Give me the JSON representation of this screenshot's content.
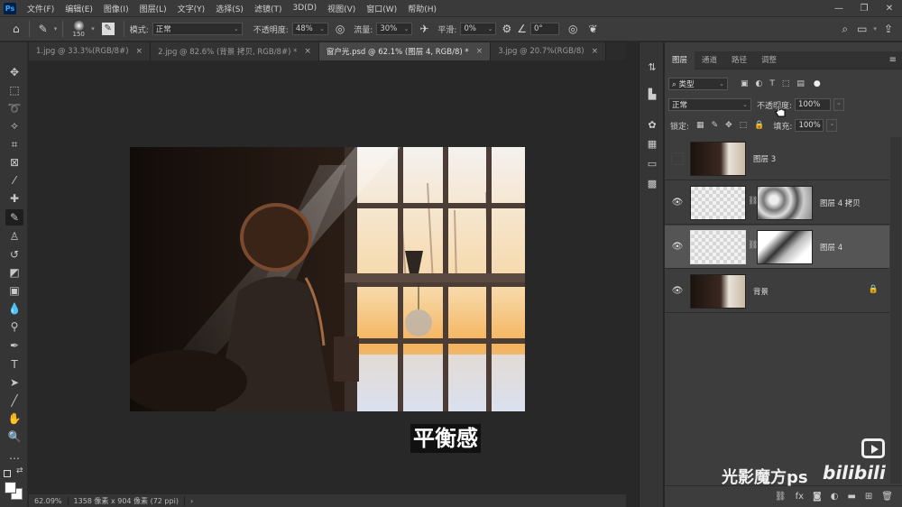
{
  "menubar": {
    "logo": "Ps",
    "items": [
      "文件(F)",
      "编辑(E)",
      "图像(I)",
      "图层(L)",
      "文字(Y)",
      "选择(S)",
      "滤镜(T)",
      "3D(D)",
      "视图(V)",
      "窗口(W)",
      "帮助(H)"
    ],
    "minimize": "—",
    "restore": "❐",
    "close": "✕"
  },
  "options": {
    "brush_size": "150",
    "mode_label": "模式:",
    "mode_value": "正常",
    "opacity_label": "不透明度:",
    "opacity_value": "48%",
    "flow_label": "流量:",
    "flow_value": "30%",
    "smoothing_label": "平滑:",
    "smoothing_value": "0%",
    "angle_value": "0°"
  },
  "tabs": [
    {
      "label": "1.jpg @ 33.3%(RGB/8#)",
      "close": "×"
    },
    {
      "label": "2.jpg @ 82.6% (背景 拷贝, RGB/8#) *",
      "close": "×"
    },
    {
      "label": "窗户光.psd @ 62.1% (图层 4, RGB/8) *",
      "close": "×"
    },
    {
      "label": "3.jpg @ 20.7%(RGB/8)",
      "close": "×"
    }
  ],
  "subtitle": "平衡感",
  "status": {
    "zoom": "62.09%",
    "doc_info": "1358 像素 x 904 像素 (72 ppi)",
    "arrow": "›"
  },
  "layers_panel": {
    "tabs": [
      "图层",
      "通道",
      "路径",
      "调整"
    ],
    "filter_kind": "类型",
    "blend_mode": "正常",
    "opacity_label": "不透明度:",
    "opacity_value": "100%",
    "lock_label": "锁定:",
    "fill_label": "填充:",
    "fill_value": "100%",
    "layers": [
      {
        "name": "图层 3",
        "visible": false
      },
      {
        "name": "图层 4 拷贝",
        "visible": true
      },
      {
        "name": "图层 4",
        "visible": true
      },
      {
        "name": "背景",
        "visible": true
      }
    ]
  },
  "watermark": {
    "text": "光影魔方ps",
    "logo": "bilibili"
  },
  "colors": {
    "app_bg": "#282828",
    "panel_bg": "#3d3d3d",
    "selected_layer": "#555555",
    "accent_ps": "#31a8ff"
  }
}
